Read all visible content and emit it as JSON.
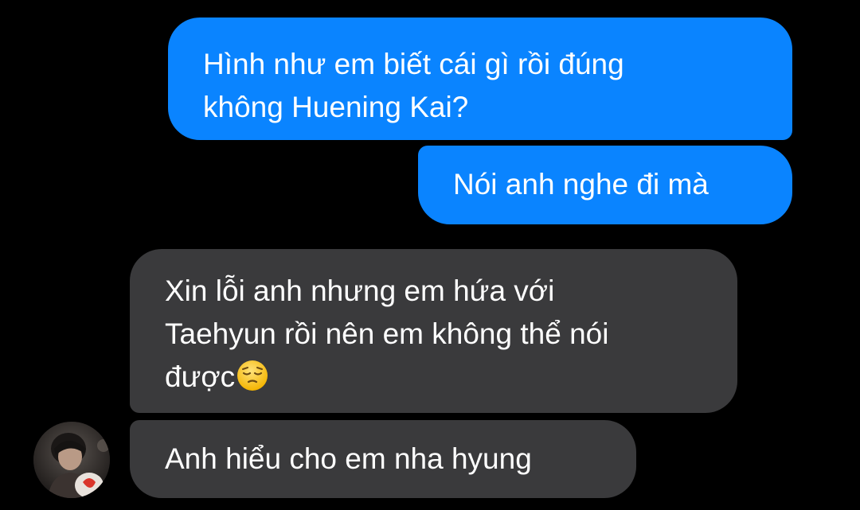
{
  "colors": {
    "background": "#000000",
    "outgoing_bubble": "#0a84ff",
    "incoming_bubble": "#3a3a3c",
    "text": "#ffffff"
  },
  "messages": [
    {
      "direction": "outgoing",
      "text": "Hình như em biết cái gì rồi đúng\nkhông Huening Kai?"
    },
    {
      "direction": "outgoing",
      "text": "Nói anh nghe đi mà"
    },
    {
      "direction": "incoming",
      "text": "Xin lỗi anh nhưng em hứa với\nTaehyun rồi nên em không thể nói\nđược",
      "emoji": "pensive-face-emoji"
    },
    {
      "direction": "incoming",
      "text": "Anh hiểu cho em nha hyung"
    }
  ],
  "contact": {
    "avatar_icon": "profile-photo"
  }
}
